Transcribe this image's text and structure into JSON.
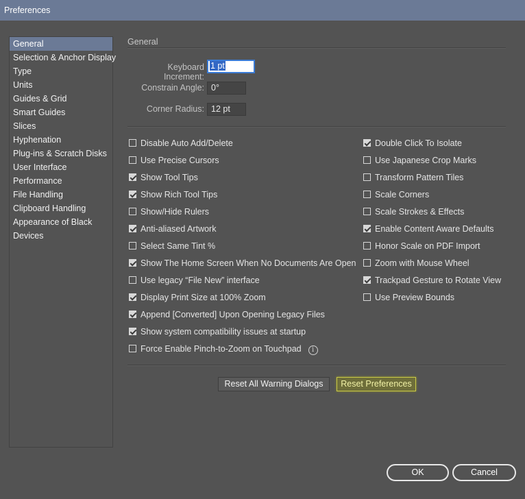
{
  "window": {
    "title": "Preferences"
  },
  "sidebar": {
    "items": [
      {
        "label": "General",
        "active": true
      },
      {
        "label": "Selection & Anchor Display"
      },
      {
        "label": "Type"
      },
      {
        "label": "Units"
      },
      {
        "label": "Guides & Grid"
      },
      {
        "label": "Smart Guides"
      },
      {
        "label": "Slices"
      },
      {
        "label": "Hyphenation"
      },
      {
        "label": "Plug-ins & Scratch Disks"
      },
      {
        "label": "User Interface"
      },
      {
        "label": "Performance"
      },
      {
        "label": "File Handling"
      },
      {
        "label": "Clipboard Handling"
      },
      {
        "label": "Appearance of Black"
      },
      {
        "label": "Devices"
      }
    ]
  },
  "general": {
    "header": "General",
    "keyboard_increment": {
      "label": "Keyboard Increment:",
      "value": "1 pt"
    },
    "constrain_angle": {
      "label": "Constrain Angle:",
      "value": "0°"
    },
    "corner_radius": {
      "label": "Corner Radius:",
      "value": "12 pt"
    }
  },
  "options_left": [
    {
      "label": "Disable Auto Add/Delete",
      "checked": false
    },
    {
      "label": "Use Precise Cursors",
      "checked": false
    },
    {
      "label": "Show Tool Tips",
      "checked": true
    },
    {
      "label": "Show Rich Tool Tips",
      "checked": true
    },
    {
      "label": "Show/Hide Rulers",
      "checked": false
    },
    {
      "label": "Anti-aliased Artwork",
      "checked": true
    },
    {
      "label": "Select Same Tint %",
      "checked": false
    },
    {
      "label": "Show The Home Screen When No Documents Are Open",
      "checked": true
    },
    {
      "label": "Use legacy “File New” interface",
      "checked": false
    },
    {
      "label": "Display Print Size at 100% Zoom",
      "checked": true
    },
    {
      "label": "Append [Converted] Upon Opening Legacy Files",
      "checked": true
    },
    {
      "label": "Show system compatibility issues at startup",
      "checked": true
    },
    {
      "label": "Force Enable Pinch-to-Zoom on Touchpad",
      "checked": false
    }
  ],
  "options_right": [
    {
      "label": "Double Click To Isolate",
      "checked": true
    },
    {
      "label": "Use Japanese Crop Marks",
      "checked": false
    },
    {
      "label": "Transform Pattern Tiles",
      "checked": false
    },
    {
      "label": "Scale Corners",
      "checked": false
    },
    {
      "label": "Scale Strokes & Effects",
      "checked": false
    },
    {
      "label": "Enable Content Aware Defaults",
      "checked": true
    },
    {
      "label": "Honor Scale on PDF Import",
      "checked": false
    },
    {
      "label": "Zoom with Mouse Wheel",
      "checked": false
    },
    {
      "label": "Trackpad Gesture to Rotate View",
      "checked": true
    },
    {
      "label": "Use Preview Bounds",
      "checked": false
    }
  ],
  "info_glyph": "i",
  "buttons": {
    "reset_warnings": "Reset All Warning Dialogs",
    "reset_preferences": "Reset Preferences",
    "ok": "OK",
    "cancel": "Cancel"
  },
  "colors": {
    "accent": "#6b7a96",
    "highlight": "#c9c948",
    "background": "#535353"
  }
}
